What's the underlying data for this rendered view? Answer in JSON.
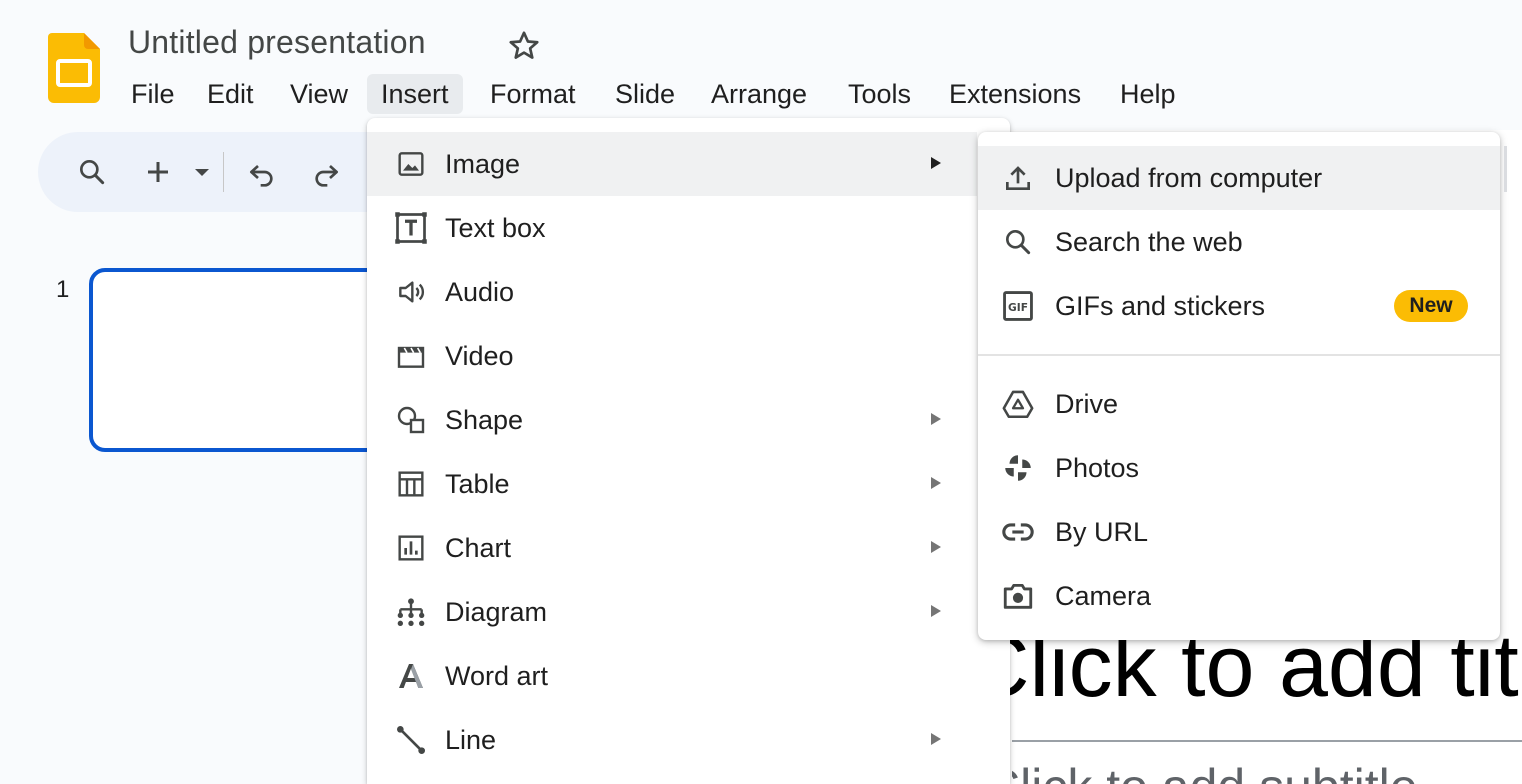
{
  "app": {
    "doc_title": "Untitled presentation",
    "logo_icon": "google-slides-logo-icon",
    "accent": "#0b57d0",
    "logo_color": "#fbbc04"
  },
  "menu_bar": [
    {
      "label": "File"
    },
    {
      "label": "Edit"
    },
    {
      "label": "View"
    },
    {
      "label": "Insert",
      "active": true
    },
    {
      "label": "Format"
    },
    {
      "label": "Slide"
    },
    {
      "label": "Arrange"
    },
    {
      "label": "Tools"
    },
    {
      "label": "Extensions"
    },
    {
      "label": "Help"
    }
  ],
  "toolbar": {
    "icons": [
      "search-icon",
      "new-slide-plus-icon",
      "dropdown-caret-icon",
      "undo-icon",
      "redo-icon"
    ]
  },
  "filmstrip": {
    "slide_number": "1"
  },
  "canvas": {
    "title_placeholder": "Click to add title",
    "subtitle_placeholder": "Click to add subtitle"
  },
  "insert_menu": {
    "items": [
      {
        "label": "Image",
        "icon": "image-icon",
        "has_submenu": true,
        "highlighted": true
      },
      {
        "label": "Text box",
        "icon": "text-box-icon",
        "has_submenu": false
      },
      {
        "label": "Audio",
        "icon": "audio-icon",
        "has_submenu": false
      },
      {
        "label": "Video",
        "icon": "video-icon",
        "has_submenu": false
      },
      {
        "label": "Shape",
        "icon": "shape-icon",
        "has_submenu": true
      },
      {
        "label": "Table",
        "icon": "table-icon",
        "has_submenu": true
      },
      {
        "label": "Chart",
        "icon": "chart-icon",
        "has_submenu": true
      },
      {
        "label": "Diagram",
        "icon": "diagram-icon",
        "has_submenu": true
      },
      {
        "label": "Word art",
        "icon": "word-art-icon",
        "has_submenu": false
      },
      {
        "label": "Line",
        "icon": "line-icon",
        "has_submenu": true
      }
    ]
  },
  "image_submenu": {
    "items": [
      {
        "label": "Upload from computer",
        "icon": "upload-icon",
        "highlighted": true
      },
      {
        "label": "Search the web",
        "icon": "search-icon"
      },
      {
        "label": "GIFs and stickers",
        "icon": "gif-icon",
        "badge": "New"
      },
      {
        "label": "Drive",
        "icon": "drive-icon"
      },
      {
        "label": "Photos",
        "icon": "photos-icon"
      },
      {
        "label": "By URL",
        "icon": "link-icon"
      },
      {
        "label": "Camera",
        "icon": "camera-icon"
      }
    ],
    "badge_color": "#fbbc04"
  }
}
